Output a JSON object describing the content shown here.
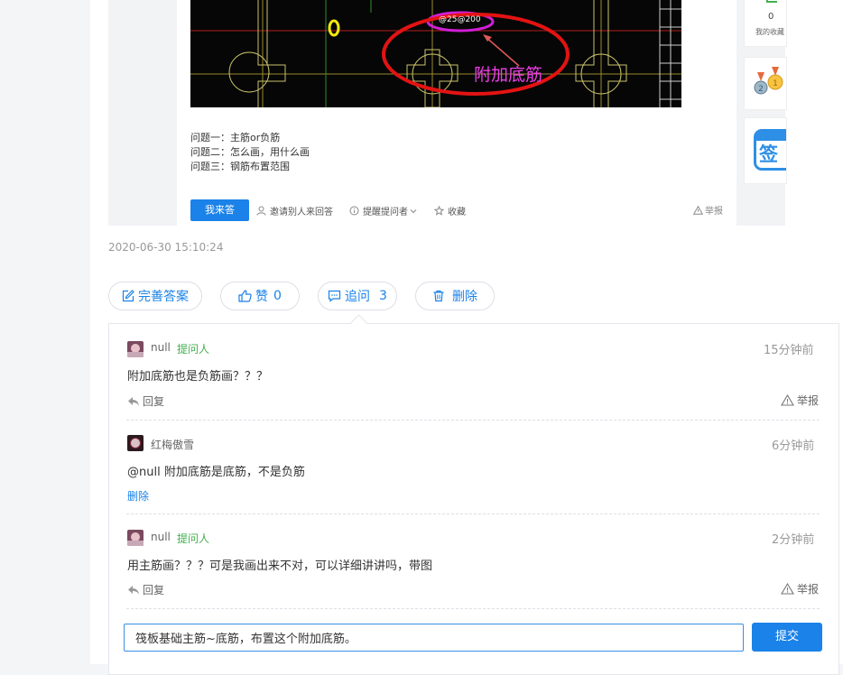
{
  "question_embed": {
    "image_annotation": "附加底筋",
    "rebar_label": "@25@200",
    "lines": [
      "问题一：主筋or负筋",
      "问题二：怎么画，用什么画",
      "问题三：钢筋布置范围"
    ],
    "answer_button": "我来答",
    "actions": [
      "邀请别人来回答",
      "提醒提问者",
      "收藏"
    ],
    "report": "举报"
  },
  "right_sidebar": {
    "favorites_count": "0",
    "favorites_label": "我的收藏",
    "sign_in_char": "签"
  },
  "timestamp": "2020-06-30 15:10:24",
  "toolbar": {
    "improve_label": "完善答案",
    "like_label": "赞",
    "like_count": "0",
    "followup_label": "追问",
    "followup_count": "3",
    "delete_label": "删除"
  },
  "comments": [
    {
      "author": "null",
      "tag": "提问人",
      "time": "15分钟前",
      "text": "附加底筋也是负筋画？？？",
      "reply_label": "回复",
      "report_label": "举报"
    },
    {
      "author": "红梅傲雪",
      "time": "6分钟前",
      "text": "@null 附加底筋是底筋，不是负筋",
      "delete_label": "删除"
    },
    {
      "author": "null",
      "tag": "提问人",
      "time": "2分钟前",
      "text": "用主筋画？？？可是我画出来不对，可以详细讲讲吗，带图",
      "reply_label": "回复",
      "report_label": "举报"
    }
  ],
  "reply_box": {
    "value": "筏板基础主筋~底筋，布置这个附加底筋。",
    "submit_label": "提交"
  },
  "colors": {
    "accent": "#1a82e8",
    "asker_tag": "#42b04d",
    "annotation": "#ee3ee8"
  }
}
